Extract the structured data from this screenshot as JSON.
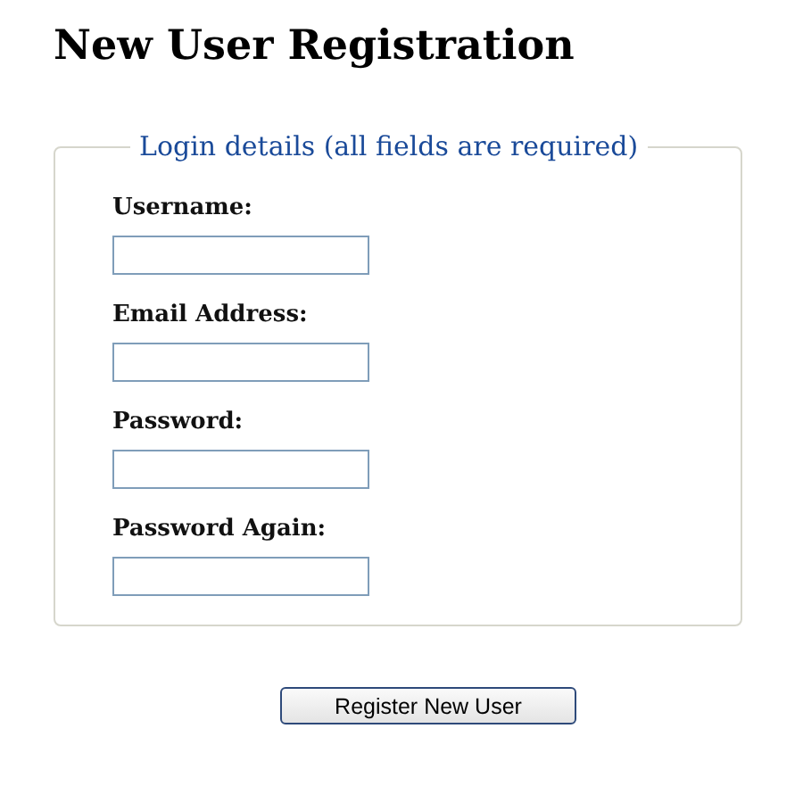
{
  "title": "New User Registration",
  "fieldset": {
    "legend": "Login details (all fields are required)",
    "fields": [
      {
        "label": "Username:"
      },
      {
        "label": "Email Address:"
      },
      {
        "label": "Password:"
      },
      {
        "label": "Password Again:"
      }
    ]
  },
  "button": "Register New User"
}
